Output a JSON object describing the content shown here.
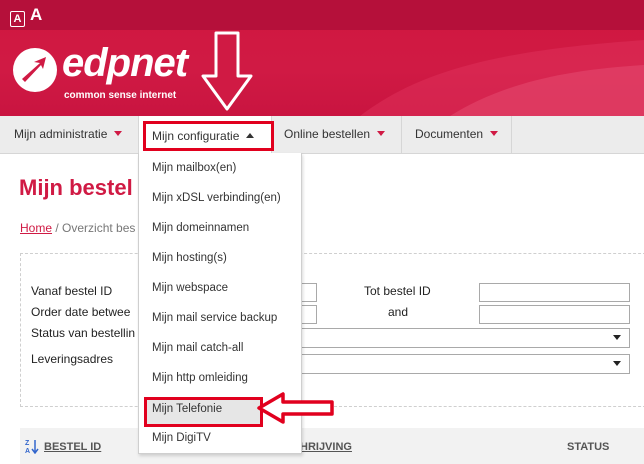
{
  "font_controls": {
    "small": "A",
    "large": "A"
  },
  "brand": {
    "name": "edpnet",
    "tagline": "common sense internet",
    "color": "#d01a44"
  },
  "nav": {
    "items": [
      {
        "label": "Mijn administratie"
      },
      {
        "label": "Mijn configuratie"
      },
      {
        "label": "Online bestellen"
      },
      {
        "label": "Documenten"
      }
    ]
  },
  "dropdown": {
    "items": [
      "Mijn mailbox(en)",
      "Mijn xDSL verbinding(en)",
      "Mijn domeinnamen",
      "Mijn hosting(s)",
      "Mijn webspace",
      "Mijn mail service backup",
      "Mijn mail catch-all",
      "Mijn http omleiding",
      "Mijn Telefonie",
      "Mijn DigiTV"
    ]
  },
  "page": {
    "title": "Mijn bestel",
    "breadcrumb_home": "Home",
    "breadcrumb_current": " / Overzicht bes"
  },
  "filter": {
    "from_id_label": "Vanaf bestel ID",
    "to_id_label": "Tot bestel ID",
    "date_label": "Order date betwee",
    "and_label": "and",
    "status_label": "Status van bestellin",
    "address_label": "Leveringsadres"
  },
  "table": {
    "col_id": "BESTEL ID",
    "col_desc": "HRIJVING",
    "col_status": "STATUS"
  },
  "highlight_color": "#e1001e"
}
